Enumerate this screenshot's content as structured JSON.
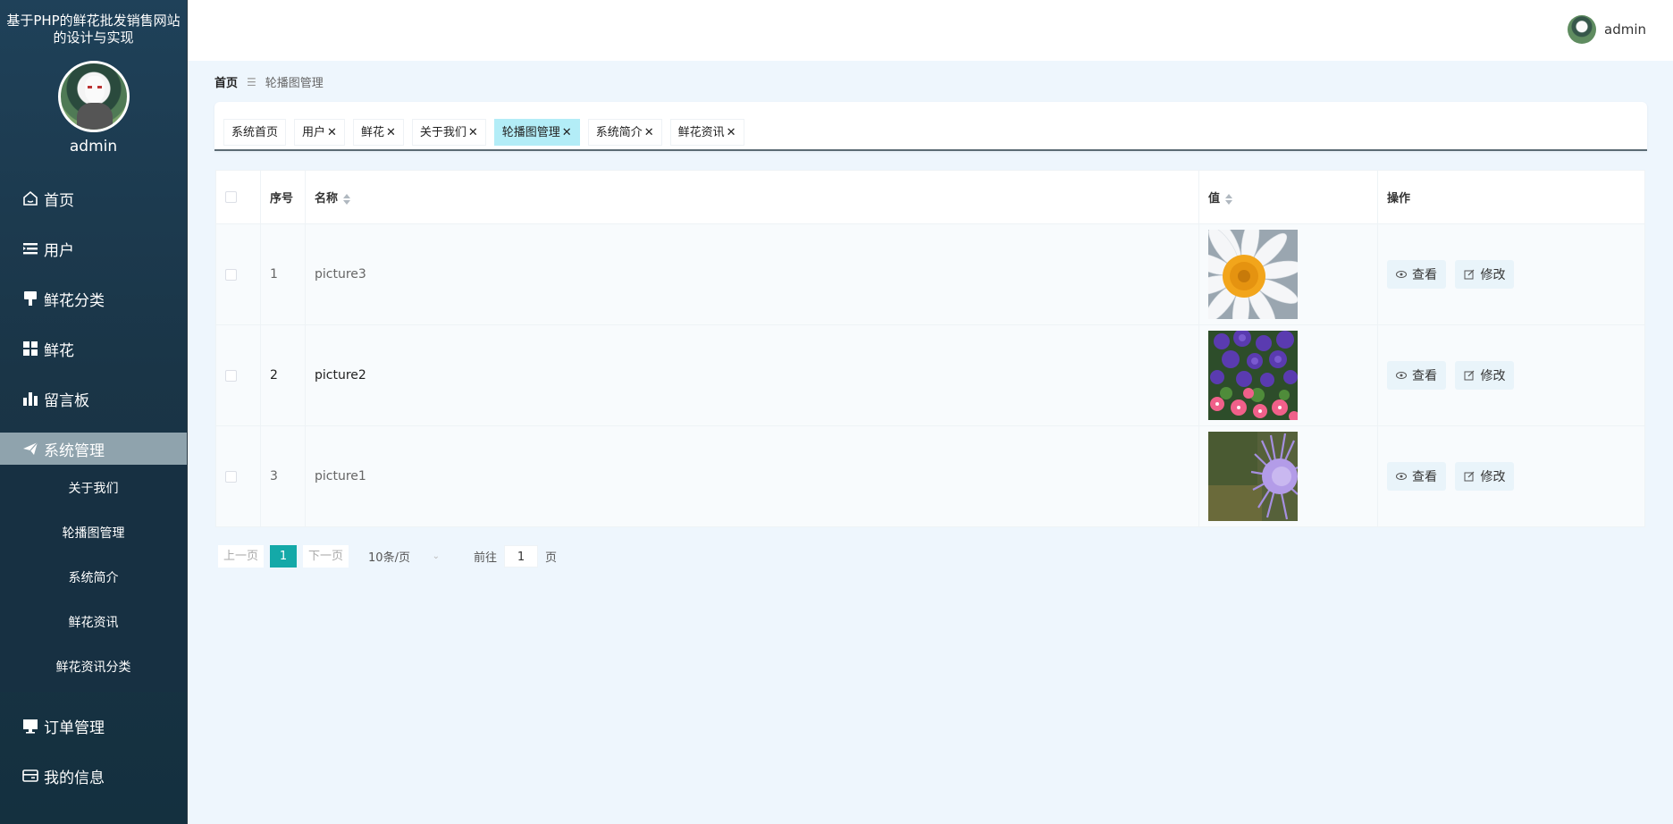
{
  "sidebar": {
    "site_title": "基于PHP的鲜花批发销售网站的设计与实现",
    "username": "admin",
    "menu": [
      {
        "label": "首页",
        "icon": "home-icon"
      },
      {
        "label": "用户",
        "icon": "list-icon"
      },
      {
        "label": "鲜花分类",
        "icon": "brush-icon"
      },
      {
        "label": "鲜花",
        "icon": "grid-icon"
      },
      {
        "label": "留言板",
        "icon": "bar-chart-icon"
      }
    ],
    "active_menu": {
      "label": "系统管理",
      "icon": "send-icon"
    },
    "submenu": [
      "关于我们",
      "轮播图管理",
      "系统简介",
      "鲜花资讯",
      "鲜花资讯分类"
    ],
    "menu_bottom": [
      {
        "label": "订单管理",
        "icon": "monitor-icon"
      },
      {
        "label": "我的信息",
        "icon": "card-icon"
      }
    ]
  },
  "topbar": {
    "username": "admin"
  },
  "breadcrumb": {
    "home": "首页",
    "separator": "☰",
    "current": "轮播图管理"
  },
  "tabs": [
    {
      "label": "系统首页",
      "closable": false
    },
    {
      "label": "用户",
      "closable": true
    },
    {
      "label": "鲜花",
      "closable": true
    },
    {
      "label": "关于我们",
      "closable": true
    },
    {
      "label": "轮播图管理",
      "closable": true,
      "active": true
    },
    {
      "label": "系统简介",
      "closable": true
    },
    {
      "label": "鲜花资讯",
      "closable": true
    }
  ],
  "table": {
    "headers": {
      "index": "序号",
      "name": "名称",
      "value": "值",
      "actions": "操作"
    },
    "rows": [
      {
        "index": "1",
        "name": "picture3",
        "image": "daisy"
      },
      {
        "index": "2",
        "name": "picture2",
        "image": "petunias"
      },
      {
        "index": "3",
        "name": "picture1",
        "image": "purple-aster"
      }
    ],
    "actions": {
      "view": "查看",
      "edit": "修改"
    }
  },
  "pagination": {
    "prev": "上一页",
    "current_page": "1",
    "next": "下一页",
    "page_size": "10条/页",
    "goto_label": "前往",
    "goto_value": "1",
    "page_suffix": "页"
  },
  "colors": {
    "accent": "#14a9a8",
    "active_tab": "#b3edf7",
    "sidebar": "#1f4159"
  }
}
